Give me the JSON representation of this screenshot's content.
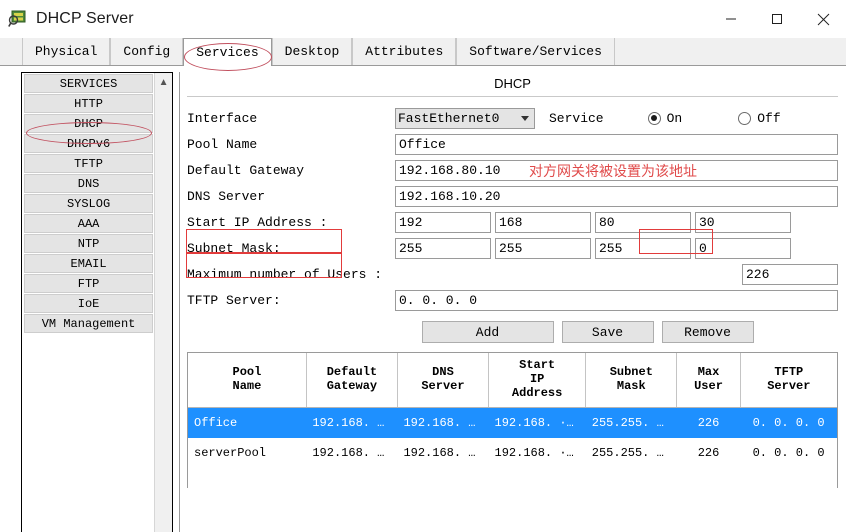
{
  "window": {
    "title": "DHCP Server",
    "icon": "dhcp-server-icon",
    "controls": {
      "minimize": "minimize-icon",
      "maximize": "maximize-icon",
      "close": "close-icon"
    }
  },
  "tabs": [
    {
      "label": "Physical",
      "active": false
    },
    {
      "label": "Config",
      "active": false
    },
    {
      "label": "Services",
      "active": true
    },
    {
      "label": "Desktop",
      "active": false
    },
    {
      "label": "Attributes",
      "active": false
    },
    {
      "label": "Software/Services",
      "active": false
    }
  ],
  "sidebar": {
    "items": [
      {
        "label": "SERVICES"
      },
      {
        "label": "HTTP"
      },
      {
        "label": "DHCP"
      },
      {
        "label": "DHCPv6"
      },
      {
        "label": "TFTP"
      },
      {
        "label": "DNS"
      },
      {
        "label": "SYSLOG"
      },
      {
        "label": "AAA"
      },
      {
        "label": "NTP"
      },
      {
        "label": "EMAIL"
      },
      {
        "label": "FTP"
      },
      {
        "label": "IoE"
      },
      {
        "label": "VM Management"
      }
    ],
    "scroll_up_icon": "chevron-up-icon"
  },
  "panel": {
    "title": "DHCP",
    "interface": {
      "label": "Interface",
      "value": "FastEthernet0",
      "caret_icon": "chevron-down-icon"
    },
    "service": {
      "label": "Service",
      "on_label": "On",
      "off_label": "Off",
      "selected": "On"
    },
    "pool_name": {
      "label": "Pool Name",
      "value": "Office"
    },
    "default_gateway": {
      "label": "Default Gateway",
      "value": "192.168.80.10"
    },
    "dns_server": {
      "label": "DNS Server",
      "value": "192.168.10.20"
    },
    "start_ip": {
      "label": "Start IP Address :",
      "octets": [
        "192",
        "168",
        "80",
        "30"
      ]
    },
    "subnet_mask": {
      "label": "Subnet Mask:",
      "octets": [
        "255",
        "255",
        "255",
        "0"
      ]
    },
    "max_users": {
      "label": "Maximum number of Users :",
      "value": "226"
    },
    "tftp_server": {
      "label": "TFTP Server:",
      "value": "0. 0. 0. 0"
    },
    "buttons": {
      "add": "Add",
      "save": "Save",
      "remove": "Remove"
    }
  },
  "annotations": {
    "gateway_note": "对方网关将被设置为该地址",
    "accent_red": "#e04a4a",
    "ellipse_red": "#c14f5e",
    "box_red": "#e23b3b",
    "selection_blue": "#1e90ff"
  },
  "table": {
    "headers": [
      "Pool\nName",
      "Default\nGateway",
      "DNS\nServer",
      "Start\nIP\nAddress",
      "Subnet\nMask",
      "Max\nUser",
      "TFTP\nServer"
    ],
    "headers_lines": [
      [
        "Pool",
        "Name"
      ],
      [
        "Default",
        "Gateway"
      ],
      [
        "DNS",
        "Server"
      ],
      [
        "Start",
        "IP",
        "Address"
      ],
      [
        "Subnet",
        "Mask"
      ],
      [
        "Max",
        "User"
      ],
      [
        "TFTP",
        "Server"
      ]
    ],
    "rows": [
      {
        "selected": true,
        "cells": [
          "Office",
          "192.168. ···",
          "192.168. ···",
          "192.168. ···",
          "255.255. ···",
          "226",
          "0. 0. 0. 0"
        ]
      },
      {
        "selected": false,
        "cells": [
          "serverPool",
          "192.168. ···",
          "192.168. ···",
          "192.168. ···",
          "255.255. ···",
          "226",
          "0. 0. 0. 0"
        ]
      }
    ]
  }
}
